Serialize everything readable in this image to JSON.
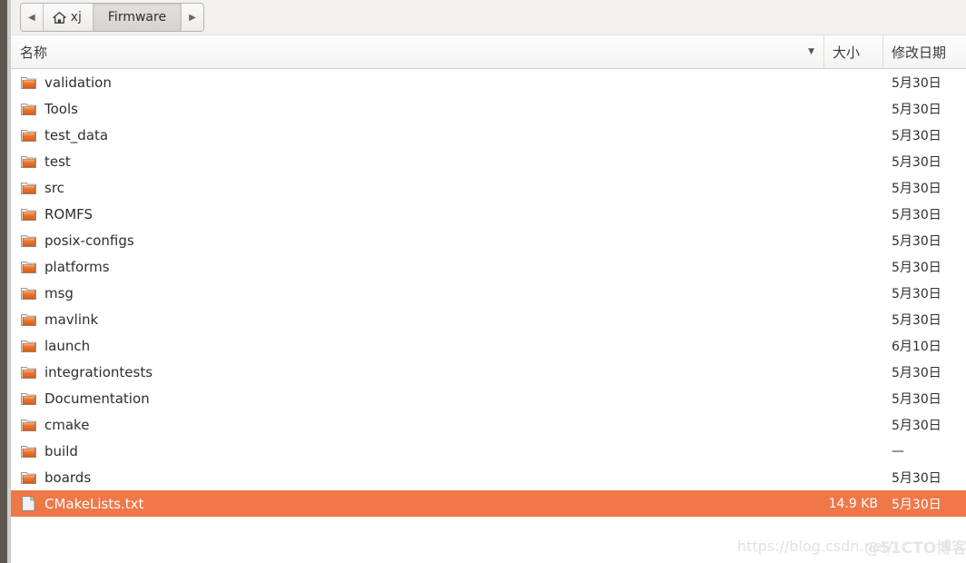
{
  "window": {
    "title": "Firmware",
    "chrome_color": "#5c584f",
    "selection_color": "#ef7748"
  },
  "pathbar": {
    "back_label": "◀",
    "back_icon": "chevron-left-icon",
    "forward_label": "▶",
    "forward_icon": "chevron-right-icon",
    "home_icon": "home-icon",
    "home_label": "xj",
    "current_label": "Firmware"
  },
  "columns": {
    "name": "名称",
    "size": "大小",
    "date": "修改日期",
    "sort_caret": "▼"
  },
  "files": [
    {
      "name": "validation",
      "icon": "folder-icon",
      "size": "",
      "date": "5月30日",
      "selected": false
    },
    {
      "name": "Tools",
      "icon": "folder-icon",
      "size": "",
      "date": "5月30日",
      "selected": false
    },
    {
      "name": "test_data",
      "icon": "folder-icon",
      "size": "",
      "date": "5月30日",
      "selected": false
    },
    {
      "name": "test",
      "icon": "folder-icon",
      "size": "",
      "date": "5月30日",
      "selected": false
    },
    {
      "name": "src",
      "icon": "folder-icon",
      "size": "",
      "date": "5月30日",
      "selected": false
    },
    {
      "name": "ROMFS",
      "icon": "folder-icon",
      "size": "",
      "date": "5月30日",
      "selected": false
    },
    {
      "name": "posix-configs",
      "icon": "folder-icon",
      "size": "",
      "date": "5月30日",
      "selected": false
    },
    {
      "name": "platforms",
      "icon": "folder-icon",
      "size": "",
      "date": "5月30日",
      "selected": false
    },
    {
      "name": "msg",
      "icon": "folder-icon",
      "size": "",
      "date": "5月30日",
      "selected": false
    },
    {
      "name": "mavlink",
      "icon": "folder-icon",
      "size": "",
      "date": "5月30日",
      "selected": false
    },
    {
      "name": "launch",
      "icon": "folder-icon",
      "size": "",
      "date": "6月10日",
      "selected": false
    },
    {
      "name": "integrationtests",
      "icon": "folder-icon",
      "size": "",
      "date": "5月30日",
      "selected": false
    },
    {
      "name": "Documentation",
      "icon": "folder-icon",
      "size": "",
      "date": "5月30日",
      "selected": false
    },
    {
      "name": "cmake",
      "icon": "folder-icon",
      "size": "",
      "date": "5月30日",
      "selected": false
    },
    {
      "name": "build",
      "icon": "folder-icon",
      "size": "",
      "date": "—",
      "selected": false
    },
    {
      "name": "boards",
      "icon": "folder-icon",
      "size": "",
      "date": "5月30日",
      "selected": false
    },
    {
      "name": "CMakeLists.txt",
      "icon": "document-icon",
      "size": "14.9 KB",
      "date": "5月30日",
      "selected": true
    }
  ],
  "watermarks": {
    "csdn": "https://blog.csdn.net/",
    "cto": "@51CTO博客"
  }
}
